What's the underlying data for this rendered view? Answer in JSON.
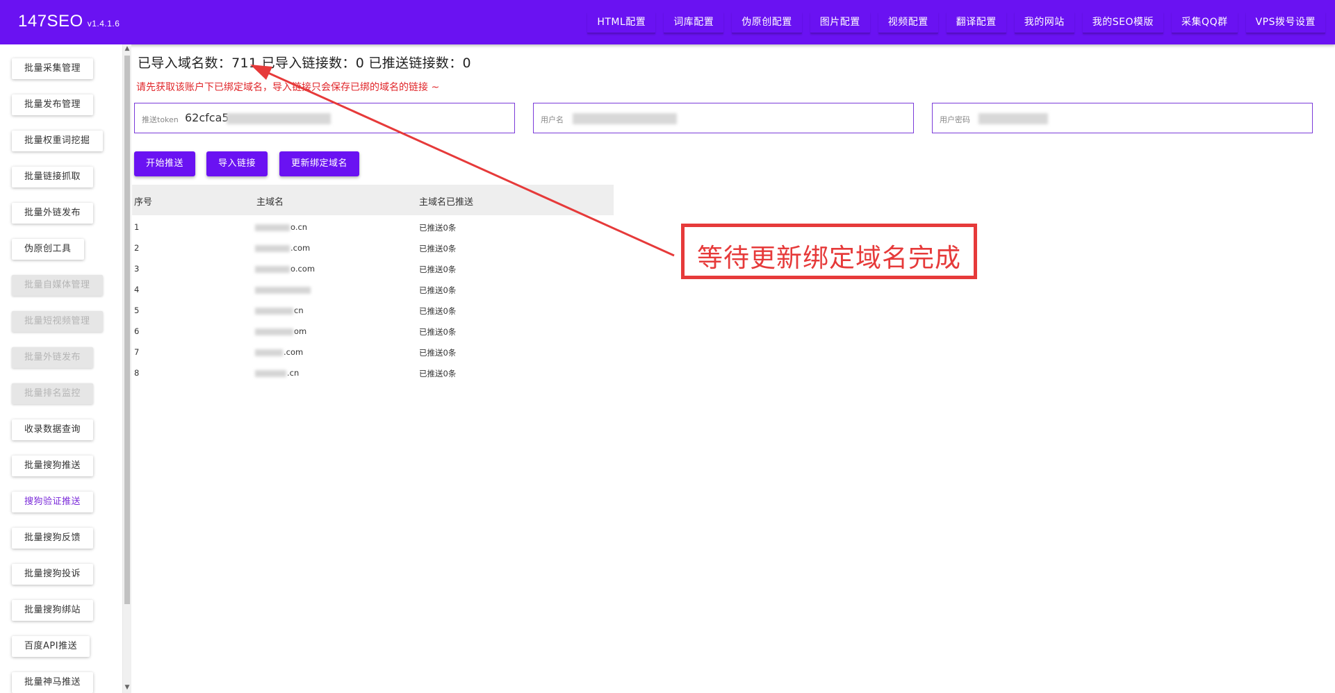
{
  "app": {
    "brand": "147SEO",
    "version": "v1.4.1.6"
  },
  "topnav": [
    {
      "label": "HTML配置"
    },
    {
      "label": "词库配置"
    },
    {
      "label": "伪原创配置"
    },
    {
      "label": "图片配置"
    },
    {
      "label": "视频配置"
    },
    {
      "label": "翻译配置"
    },
    {
      "label": "我的网站"
    },
    {
      "label": "我的SEO模版"
    },
    {
      "label": "采集QQ群"
    },
    {
      "label": "VPS拨号设置"
    }
  ],
  "sidebar": [
    {
      "label": "批量采集管理",
      "state": "normal"
    },
    {
      "label": "批量发布管理",
      "state": "normal"
    },
    {
      "label": "批量权重词挖掘",
      "state": "normal"
    },
    {
      "label": "批量链接抓取",
      "state": "normal"
    },
    {
      "label": "批量外链发布",
      "state": "normal"
    },
    {
      "label": "伪原创工具",
      "state": "normal"
    },
    {
      "label": "批量自媒体管理",
      "state": "disabled"
    },
    {
      "label": "批量短视频管理",
      "state": "disabled"
    },
    {
      "label": "批量外链发布",
      "state": "disabled"
    },
    {
      "label": "批量排名监控",
      "state": "disabled"
    },
    {
      "label": "收录数据查询",
      "state": "normal"
    },
    {
      "label": "批量搜狗推送",
      "state": "normal"
    },
    {
      "label": "搜狗验证推送",
      "state": "active"
    },
    {
      "label": "批量搜狗反馈",
      "state": "normal"
    },
    {
      "label": "批量搜狗投诉",
      "state": "normal"
    },
    {
      "label": "批量搜狗绑站",
      "state": "normal"
    },
    {
      "label": "百度API推送",
      "state": "normal"
    },
    {
      "label": "批量神马推送",
      "state": "normal"
    }
  ],
  "stats": {
    "text": "已导入域名数：711 已导入链接数：0 已推送链接数：0"
  },
  "notice": "请先获取该账户下已绑定域名，导入链接只会保存已绑的域名的链接 ~",
  "fields": {
    "token": {
      "label": "推送token",
      "value": "62cfca5"
    },
    "username": {
      "label": "用户名"
    },
    "password": {
      "label": "用户密码"
    }
  },
  "buttons": {
    "start": "开始推送",
    "import": "导入链接",
    "update": "更新绑定域名"
  },
  "table": {
    "headers": [
      "序号",
      "主域名",
      "主域名已推送"
    ],
    "rows": [
      {
        "index": "1",
        "domain": "o.cn",
        "pushed": "已推送0条"
      },
      {
        "index": "2",
        "domain": ".com",
        "pushed": "已推送0条"
      },
      {
        "index": "3",
        "domain": "o.com",
        "pushed": "已推送0条"
      },
      {
        "index": "4",
        "domain": "",
        "pushed": "已推送0条"
      },
      {
        "index": "5",
        "domain": "cn",
        "pushed": "已推送0条"
      },
      {
        "index": "6",
        "domain": "om",
        "pushed": "已推送0条"
      },
      {
        "index": "7",
        "domain": ".com",
        "pushed": "已推送0条"
      },
      {
        "index": "8",
        "domain": ".cn",
        "pushed": "已推送0条"
      }
    ]
  },
  "annotation": {
    "text": "等待更新绑定域名完成",
    "color": "#e63a3a"
  },
  "colors": {
    "accent": "#6a12f2",
    "notice": "#e0262a"
  }
}
